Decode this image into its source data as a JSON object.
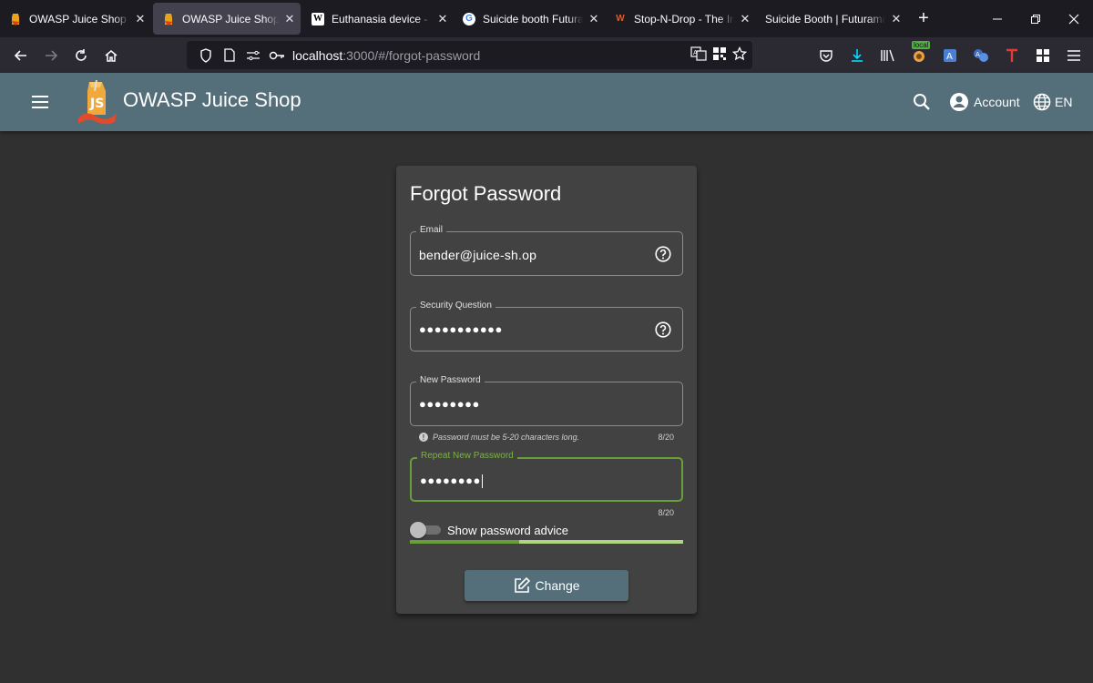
{
  "browser": {
    "tabs": [
      {
        "title": "OWASP Juice Shop",
        "icon": "juice-shop-favicon",
        "active": false
      },
      {
        "title": "OWASP Juice Shop",
        "icon": "juice-shop-favicon",
        "active": true
      },
      {
        "title": "Euthanasia device - Wi",
        "icon": "wikipedia-favicon",
        "active": false
      },
      {
        "title": "Suicide booth Futurama",
        "icon": "google-favicon",
        "active": false
      },
      {
        "title": "Stop-N-Drop - The Infi",
        "icon": "fandom-favicon",
        "active": false
      },
      {
        "title": "Suicide Booth | Futurama W",
        "icon": "none",
        "active": false
      }
    ],
    "url_host": "localhost",
    "url_path": ":3000/#/forgot-password",
    "local_badge": "local"
  },
  "header": {
    "app_title": "OWASP Juice Shop",
    "account_label": "Account",
    "language_label": "EN"
  },
  "form": {
    "title": "Forgot Password",
    "email": {
      "label": "Email",
      "value": "bender@juice-sh.op"
    },
    "security_question": {
      "label": "Security Question",
      "value": "●●●●●●●●●●●"
    },
    "new_password": {
      "label": "New Password",
      "value": "●●●●●●●●",
      "hint": "Password must be 5-20 characters long.",
      "counter": "8/20"
    },
    "repeat_password": {
      "label": "Repeat New Password",
      "value": "●●●●●●●●",
      "counter": "8/20"
    },
    "show_advice_label": "Show password advice",
    "show_advice_enabled": false,
    "password_strength_fraction": 0.4,
    "submit_label": "Change"
  },
  "colors": {
    "header_bg": "#546e7a",
    "page_bg": "#303030",
    "card_bg": "#424242",
    "focus_accent": "#689f38",
    "strength_light": "#aed581"
  }
}
